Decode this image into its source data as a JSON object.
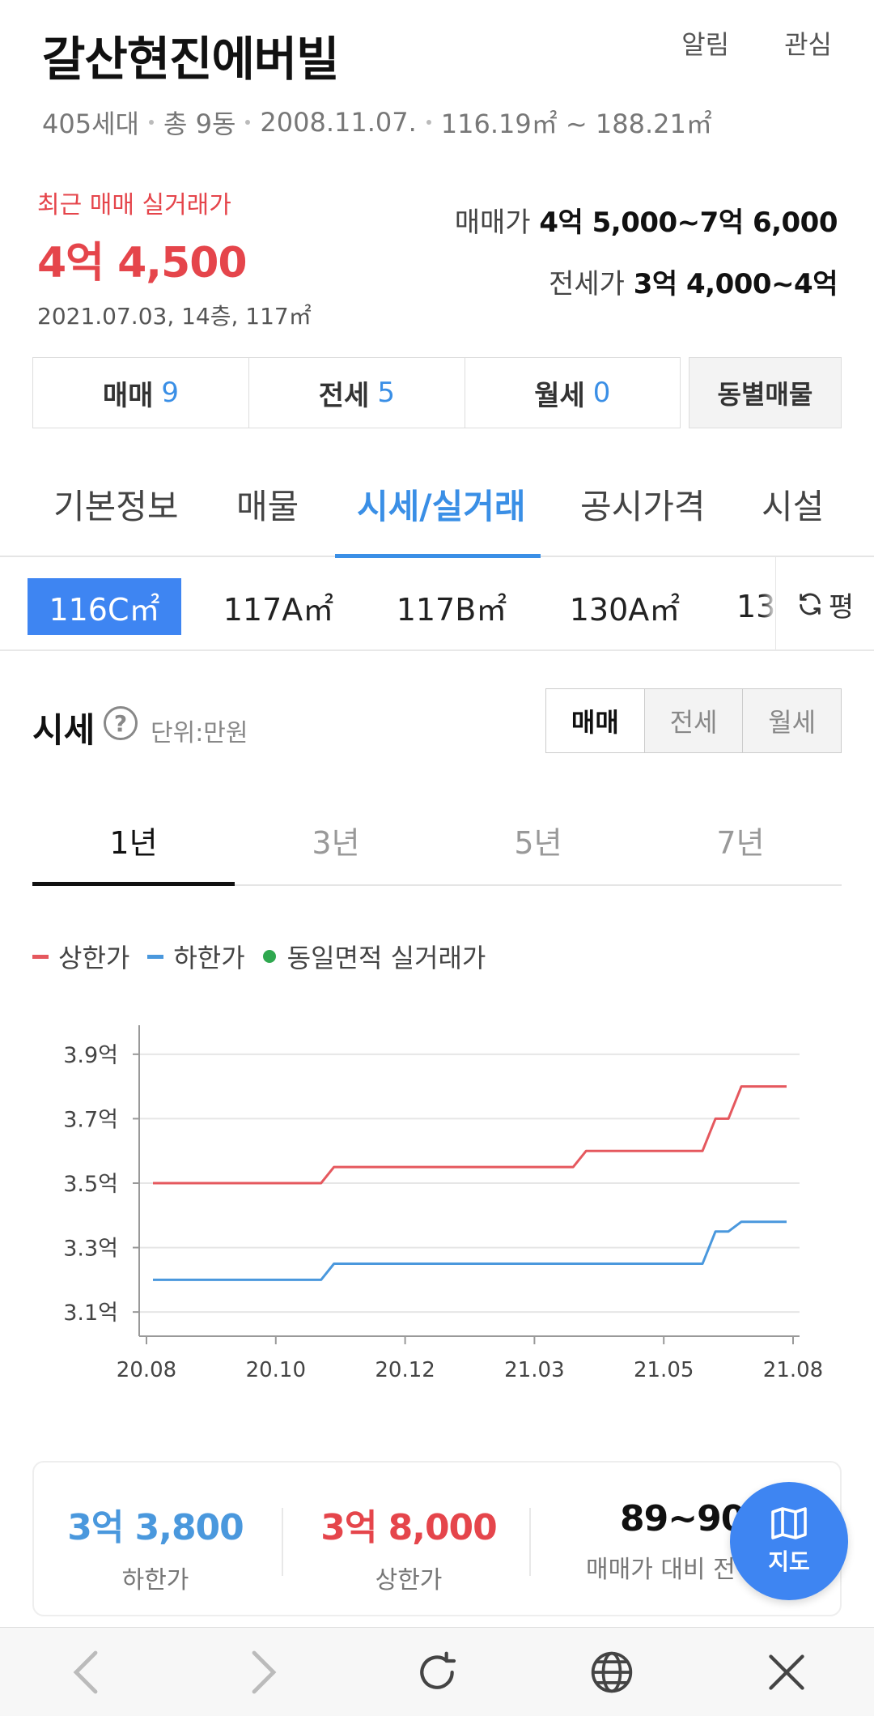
{
  "header": {
    "title": "갈산현진에버빌",
    "links": [
      "알림",
      "관심"
    ],
    "info": [
      "405세대",
      "총 9동",
      "2008.11.07.",
      "116.19㎡ ~ 188.21㎡"
    ]
  },
  "recent": {
    "label": "최근 매매 실거래가",
    "price": "4억 4,500",
    "meta": "2021.07.03, 14층, 117㎡"
  },
  "price_range": {
    "sale_label": "매매가",
    "sale_value": "4억 5,000~7억 6,000",
    "jeonse_label": "전세가",
    "jeonse_value": "3억 4,000~4억"
  },
  "counts": [
    {
      "label": "매매",
      "num": "9"
    },
    {
      "label": "전세",
      "num": "5"
    },
    {
      "label": "월세",
      "num": "0"
    }
  ],
  "dong_button": "동별매물",
  "main_tabs": [
    "기본정보",
    "매물",
    "시세/실거래",
    "공시가격",
    "시설"
  ],
  "areas": [
    "116C㎡",
    "117A㎡",
    "117B㎡",
    "130A㎡",
    "13"
  ],
  "pyeong_label": "평",
  "sise": {
    "title": "시세",
    "help": "?",
    "unit": "단위:만원",
    "toggles": [
      "매매",
      "전세",
      "월세"
    ]
  },
  "year_tabs": [
    "1년",
    "3년",
    "5년",
    "7년"
  ],
  "legend": {
    "upper": "상한가",
    "lower": "하한가",
    "deals": "동일면적 실거래가"
  },
  "colors": {
    "upper": "#e5585e",
    "lower": "#4a98dd",
    "deals": "#2fa84f",
    "accent": "#3e85f2"
  },
  "chart_data": {
    "type": "line",
    "y_tick_labels": [
      "3.1억",
      "3.3억",
      "3.5억",
      "3.7억",
      "3.9억"
    ],
    "y_ticks": [
      3.1,
      3.3,
      3.5,
      3.7,
      3.9
    ],
    "x_tick_labels": [
      "20.08",
      "20.10",
      "20.12",
      "21.03",
      "21.05",
      "21.08"
    ],
    "ylim": [
      3.03,
      3.98
    ],
    "series": [
      {
        "name": "상한가",
        "x": [
          0.01,
          0.27,
          0.29,
          0.66,
          0.68,
          0.86,
          0.88,
          0.9,
          0.92,
          0.99
        ],
        "values": [
          3.5,
          3.5,
          3.55,
          3.55,
          3.6,
          3.6,
          3.7,
          3.7,
          3.8,
          3.8
        ]
      },
      {
        "name": "하한가",
        "x": [
          0.01,
          0.27,
          0.29,
          0.86,
          0.88,
          0.9,
          0.92,
          0.99
        ],
        "values": [
          3.2,
          3.2,
          3.25,
          3.25,
          3.35,
          3.35,
          3.38,
          3.38
        ]
      }
    ]
  },
  "summary": [
    {
      "value": "3억 3,800",
      "label": "하한가"
    },
    {
      "value": "3억 8,000",
      "label": "상한가"
    },
    {
      "value": "89~90%",
      "label": "매매가 대비 전"
    }
  ],
  "map_button": "지도"
}
